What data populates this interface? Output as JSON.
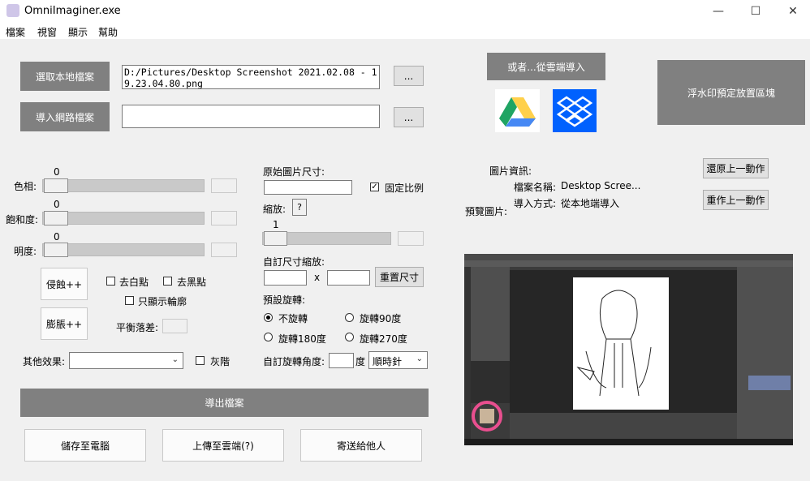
{
  "window": {
    "title": "OmniImaginer.exe",
    "minimize": "—",
    "maximize": "☐",
    "close": "✕"
  },
  "menu": [
    "檔案",
    "視窗",
    "顯示",
    "幫助"
  ],
  "import": {
    "local_button": "選取本地檔案",
    "local_path": "D:/Pictures/Desktop Screenshot 2021.02.08 - 19.23.04.80.png",
    "browse_label": "...",
    "web_button": "導入網路檔案",
    "web_path": "",
    "cloud_button": "或者...從雲端導入",
    "watermark_label": "浮水印預定放置區塊"
  },
  "adjust": {
    "hue": {
      "label": "色相:",
      "value": "0",
      "level": 0
    },
    "saturation": {
      "label": "飽和度:",
      "value": "0",
      "level": 0
    },
    "brightness": {
      "label": "明度:",
      "value": "0",
      "level": 0
    }
  },
  "morph": {
    "erode": "侵蝕++",
    "dilate": "膨脹++",
    "remove_white": "去白點",
    "remove_black": "去黑點",
    "outline_only": "只顯示輪廓",
    "balance_label": "平衡落差:"
  },
  "other": {
    "effects_label": "其他效果:",
    "effects_value": "",
    "gray_label": "灰階"
  },
  "size": {
    "original_label": "原始圖片尺寸:",
    "lock_ratio": "固定比例",
    "scale_label": "縮放:",
    "help": "?",
    "scale_value": "1",
    "scale_level": 0,
    "custom_label": "自訂尺寸縮放:",
    "times": "x",
    "reset": "重置尺寸"
  },
  "rotation": {
    "label": "預設旋轉:",
    "options": [
      "不旋轉",
      "旋轉90度",
      "旋轉180度",
      "旋轉270度"
    ],
    "selected": 0,
    "custom_label": "自訂旋轉角度:",
    "degree": "度",
    "direction": "順時針"
  },
  "info": {
    "title": "圖片資訊:",
    "name_label": "檔案名稱:",
    "name_value": "Desktop Scree...",
    "import_label": "導入方式:",
    "import_value": "從本地端導入",
    "preview_label": "預覽圖片:",
    "undo": "還原上一動作",
    "redo": "重作上一動作"
  },
  "actions": {
    "export": "導出檔案",
    "save": "儲存至電腦",
    "upload": "上傳至雲端(?)",
    "send": "寄送給他人"
  },
  "colors": {
    "gray_button": "#808080",
    "drive_green": "#1fa463",
    "drive_yellow": "#ffd04b",
    "drive_blue": "#4688f4",
    "dropbox": "#0061fe"
  }
}
